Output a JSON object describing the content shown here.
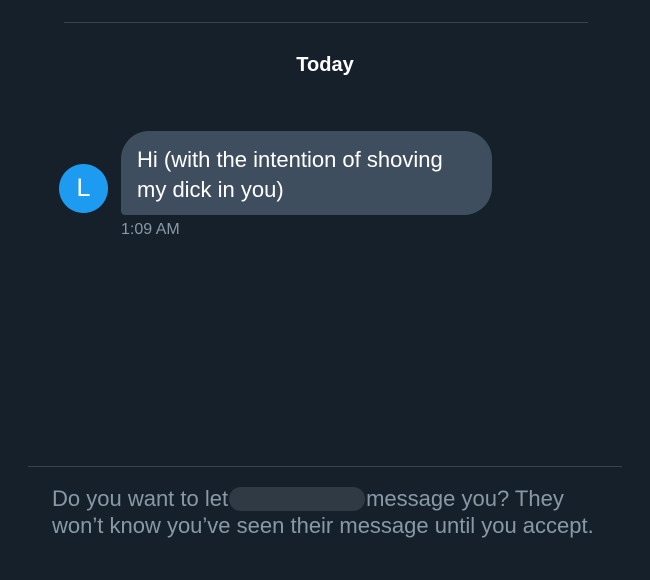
{
  "conversation": {
    "date_label": "Today",
    "message": {
      "avatar_initial": "L",
      "text": "Hi (with the intention of shoving my dick in you)",
      "time": "1:09 AM"
    }
  },
  "request": {
    "text_before": "Do you want to let",
    "text_after": "message you? They won’t know you’ve seen their message until you accept."
  },
  "colors": {
    "background": "#15202b",
    "bubble": "#3f4e5e",
    "avatar": "#1d9bf0",
    "muted_text": "#8899a6"
  }
}
